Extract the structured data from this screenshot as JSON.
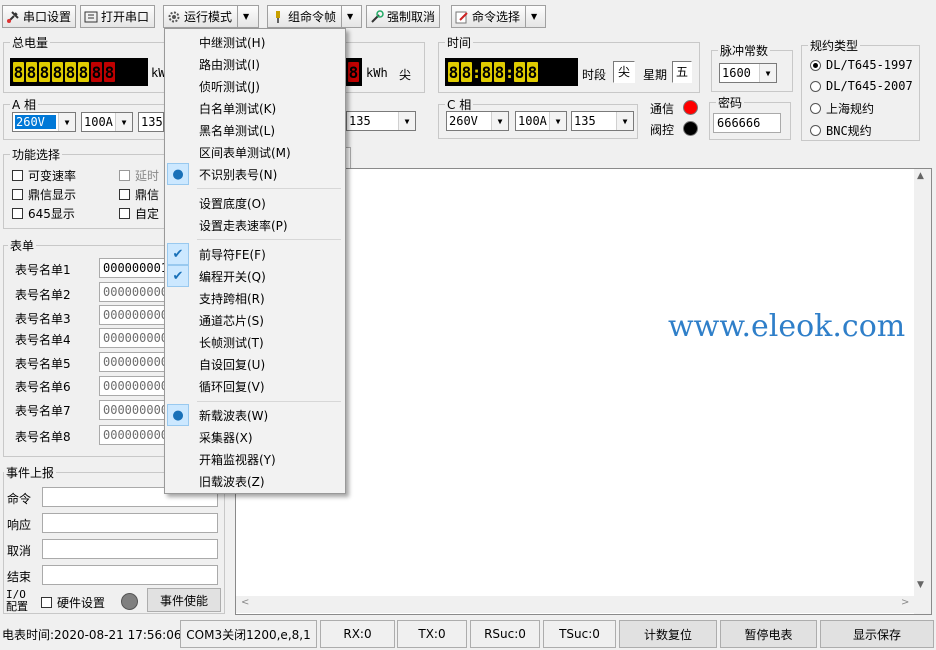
{
  "toolbar": {
    "serial_settings": "串口设置",
    "open_serial": "打开串口",
    "run_mode": "运行模式",
    "group_cmd": "组命令帧",
    "force_cancel": "强制取消",
    "cmd_select": "命令选择"
  },
  "total_energy": {
    "title": "总电量",
    "unit": "kWh",
    "rate_unit": "kWh",
    "rate": "尖"
  },
  "time_panel": {
    "title": "时间",
    "period_label": "时段",
    "period_value": "尖",
    "week_label": "星期",
    "week_value": "五"
  },
  "pulse": {
    "title": "脉冲常数",
    "value": "1600"
  },
  "protocol": {
    "title": "规约类型",
    "options": [
      "DL/T645-1997",
      "DL/T645-2007",
      "上海规约",
      "BNC规约"
    ],
    "selected": 0
  },
  "phase_a": {
    "title": "A 相",
    "voltage": "260V",
    "current": "100A",
    "third": "135"
  },
  "phase_b": {
    "third": "135"
  },
  "phase_c": {
    "title": "C 相",
    "voltage": "260V",
    "current": "100A",
    "third": "135"
  },
  "comm": {
    "comm_label": "通信",
    "valve_label": "阀控",
    "comm_color": "#ff0000",
    "valve_color": "#000000"
  },
  "password": {
    "title": "密码",
    "value": "666666"
  },
  "function": {
    "title": "功能选择",
    "items": [
      "可变速率",
      "鼎信显示",
      "645显示"
    ],
    "items2": [
      "延时",
      "鼎信",
      "自定"
    ]
  },
  "meter_list": {
    "title": "表单",
    "labels": [
      "表号名单1",
      "表号名单2",
      "表号名单3",
      "表号名单4",
      "表号名单5",
      "表号名单6",
      "表号名单7",
      "表号名单8"
    ],
    "values": [
      "000000001",
      "000000000",
      "000000000",
      "000000000",
      "000000000",
      "000000000",
      "000000000",
      "000000000"
    ]
  },
  "events": {
    "title": "事件上报",
    "labels": [
      "命令",
      "响应",
      "取消",
      "结束"
    ],
    "io_label": "I/O\n配置",
    "hw_setting": "硬件设置",
    "enable_btn": "事件使能"
  },
  "watermark": "www.eleok.com",
  "menu": {
    "items": [
      {
        "label": "中继测试(H)",
        "mark": ""
      },
      {
        "label": "路由测试(I)",
        "mark": ""
      },
      {
        "label": "侦听测试(J)",
        "mark": ""
      },
      {
        "label": "白名单测试(K)",
        "mark": ""
      },
      {
        "label": "黑名单测试(L)",
        "mark": ""
      },
      {
        "label": "区间表单测试(M)",
        "mark": ""
      },
      {
        "label": "不识别表号(N)",
        "mark": "dot"
      },
      {
        "label": "设置底度(O)",
        "mark": ""
      },
      {
        "label": "设置走表速率(P)",
        "mark": ""
      },
      {
        "label": "前导符FE(F)",
        "mark": "check"
      },
      {
        "label": "编程开关(Q)",
        "mark": "check"
      },
      {
        "label": "支持跨相(R)",
        "mark": ""
      },
      {
        "label": "通道芯片(S)",
        "mark": ""
      },
      {
        "label": "长帧测试(T)",
        "mark": ""
      },
      {
        "label": "自设回复(U)",
        "mark": ""
      },
      {
        "label": "循环回复(V)",
        "mark": ""
      },
      {
        "label": "新载波表(W)",
        "mark": "dot"
      },
      {
        "label": "采集器(X)",
        "mark": ""
      },
      {
        "label": "开箱监视器(Y)",
        "mark": ""
      },
      {
        "label": "旧载波表(Z)",
        "mark": ""
      }
    ]
  },
  "status": {
    "meter_time": "电表时间:2020-08-21 17:56:06",
    "port": "COM3关闭1200,e,8,1",
    "rx": "RX:0",
    "tx": "TX:0",
    "rsuc": "RSuc:0",
    "tsuc": "TSuc:0",
    "reset_count": "计数复位",
    "pause_meter": "暂停电表",
    "show_save": "显示保存"
  }
}
